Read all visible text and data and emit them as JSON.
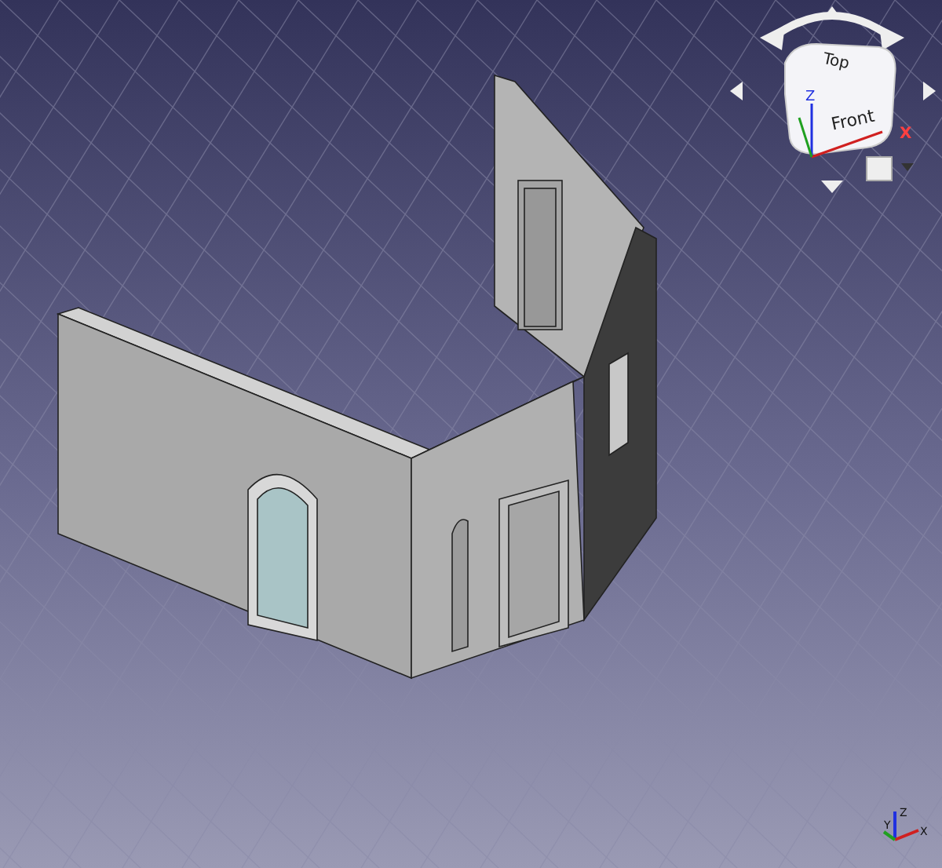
{
  "view": {
    "navigation_cube": {
      "faces": [
        "Top",
        "Front"
      ],
      "axes": [
        "Z",
        "X"
      ]
    },
    "axis_triad": {
      "labels": [
        "X",
        "Y",
        "Z"
      ]
    }
  }
}
